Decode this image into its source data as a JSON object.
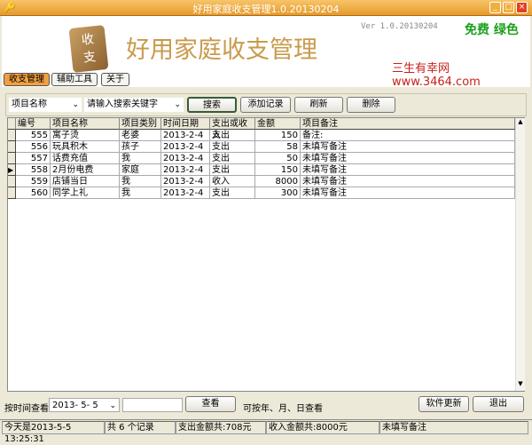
{
  "window": {
    "title": "好用家庭收支管理1.0.20130204"
  },
  "header": {
    "logo_text": "收支",
    "app_title": "好用家庭收支管理",
    "version": "Ver 1.0.20130204",
    "free_label": "免费 绿色",
    "site": "三生有幸网 www.3464.com"
  },
  "tabs": [
    {
      "label": "收支管理",
      "active": true
    },
    {
      "label": "辅助工具"
    },
    {
      "label": "关于"
    }
  ],
  "toolbar": {
    "field_select": "项目名称",
    "keyword_placeholder": "请输入搜索关键字",
    "search": "搜索",
    "add": "添加记录",
    "refresh": "刷新",
    "delete": "删除"
  },
  "table": {
    "columns": [
      "编号",
      "项目名称",
      "项目类别",
      "时间日期",
      "支出或收入",
      "金额",
      "项目备注"
    ],
    "rows": [
      [
        "555",
        "寓子烫",
        "老婆",
        "2013-2-4",
        "支出",
        "150",
        "备注:"
      ],
      [
        "556",
        "玩具积木",
        "孩子",
        "2013-2-4",
        "支出",
        "58",
        "未填写备注"
      ],
      [
        "557",
        "话费充值",
        "我",
        "2013-2-4",
        "支出",
        "50",
        "未填写备注"
      ],
      [
        "558",
        "2月份电费",
        "家庭",
        "2013-2-4",
        "支出",
        "150",
        "未填写备注"
      ],
      [
        "559",
        "店铺当日",
        "我",
        "2013-2-4",
        "收入",
        "8000",
        "未填写备注"
      ],
      [
        "560",
        "同学上礼",
        "我",
        "2013-2-4",
        "支出",
        "300",
        "未填写备注"
      ]
    ],
    "current_row": 3
  },
  "bottom": {
    "date_label": "按时间查看",
    "date_value": "2013- 5- 5",
    "view": "查看",
    "hint": "可按年、月、日查看",
    "update": "软件更新",
    "exit": "退出"
  },
  "status": [
    "今天是2013-5-5 13:25:31",
    "共 6 个记录",
    "支出金额共:708元",
    "收入金额共:8000元",
    "未填写备注"
  ]
}
